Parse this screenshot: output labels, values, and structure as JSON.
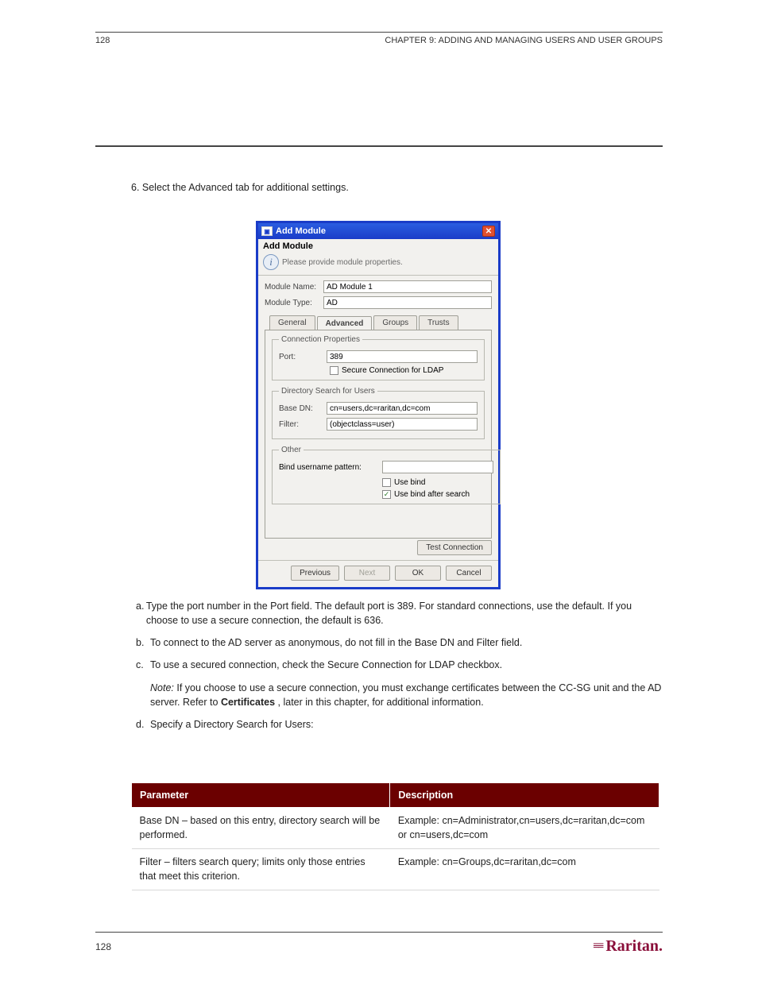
{
  "header": {
    "page": "128",
    "chapterRight": "CHAPTER 9: ADDING AND MANAGING USERS AND USER GROUPS"
  },
  "body": {
    "topNumbered": "6.   Select the Advanced tab for additional settings.",
    "afterParas": {
      "p1_label": "a.",
      "p1": "Type the port number in the Port field. The default port is 389. For standard connections, use the default. If you choose to use a secure connection, the default is 636.",
      "p2_label": "b.",
      "p2": "To connect to the AD server as anonymous, do not fill in the Base DN and Filter field.",
      "p3_label": "c.",
      "p3": "To use a secured connection, check the Secure Connection for LDAP checkbox.",
      "p4_noteTitle": "Note:",
      "p4_noteBody": "If you choose to use a secure connection, you must exchange certificates between the CC-SG unit and the AD server. Refer to ",
      "p4_noteLink": "Certificates",
      "p4_noteTail": ", later in this chapter, for additional information.",
      "p5_label": "d.",
      "p5": "Specify a Directory Search for Users:"
    }
  },
  "dialog": {
    "title": "Add Module",
    "paneTitle": "Add Module",
    "info": "Please provide module properties.",
    "moduleNameLabel": "Module Name:",
    "moduleNameValue": "AD Module 1",
    "moduleTypeLabel": "Module Type:",
    "moduleTypeValue": "AD",
    "tabs": [
      "General",
      "Advanced",
      "Groups",
      "Trusts"
    ],
    "connLegend": "Connection Properties",
    "portLabel": "Port:",
    "portValue": "389",
    "secureLdap": "Secure Connection for LDAP",
    "dirLegend": "Directory Search for Users",
    "baseDnLabel": "Base DN:",
    "baseDnValue": "cn=users,dc=raritan,dc=com",
    "filterLabel": "Filter:",
    "filterValue": "(objectclass=user)",
    "otherLegend": "Other",
    "bindPatternLabel": "Bind username pattern:",
    "bindPatternValue": "",
    "useBind": "Use bind",
    "useBindAfter": "Use bind after search",
    "testConn": "Test Connection",
    "previous": "Previous",
    "next": "Next",
    "ok": "OK",
    "cancel": "Cancel"
  },
  "table": {
    "headers": [
      "Parameter",
      "Description"
    ],
    "rows": [
      {
        "c1": "Base DN – based on this entry, directory search will be performed.",
        "c2": "Example: cn=Administrator,cn=users,dc=raritan,dc=com or cn=users,dc=com"
      },
      {
        "c1": "Filter – filters search query; limits only those entries that meet this criterion.",
        "c2": "Example: cn=Groups,dc=raritan,dc=com"
      }
    ]
  },
  "footer": {
    "pageNum": "128",
    "logo": "Raritan."
  },
  "chart_data": {
    "type": "table",
    "title": "Directory Search for Users parameters",
    "columns": [
      "Parameter",
      "Description"
    ],
    "rows": [
      [
        "Base DN – based on this entry, directory search will be performed.",
        "Example: cn=Administrator,cn=users,dc=raritan,dc=com or cn=users,dc=com"
      ],
      [
        "Filter – filters search query; limits only those entries that meet this criterion.",
        "Example: cn=Groups,dc=raritan,dc=com"
      ]
    ]
  }
}
